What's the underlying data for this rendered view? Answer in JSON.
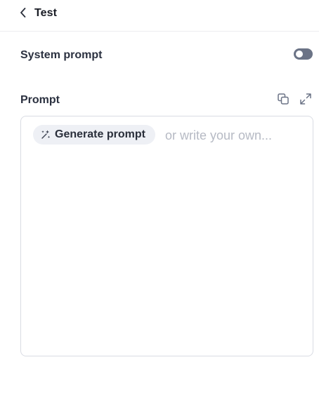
{
  "header": {
    "title": "Test",
    "back_icon": "chevron-left-icon"
  },
  "system_prompt": {
    "label": "System prompt",
    "toggle_on": false
  },
  "prompt": {
    "label": "Prompt",
    "copy_icon": "copy-icon",
    "expand_icon": "expand-icon",
    "generate_button_label": "Generate prompt",
    "generate_icon": "sparkle-icon",
    "placeholder": "or write your own..."
  },
  "colors": {
    "toggle_off": "#6b7386",
    "chip_bg": "#eef0f5",
    "placeholder": "#b6bac4",
    "border": "#d9dce3"
  }
}
